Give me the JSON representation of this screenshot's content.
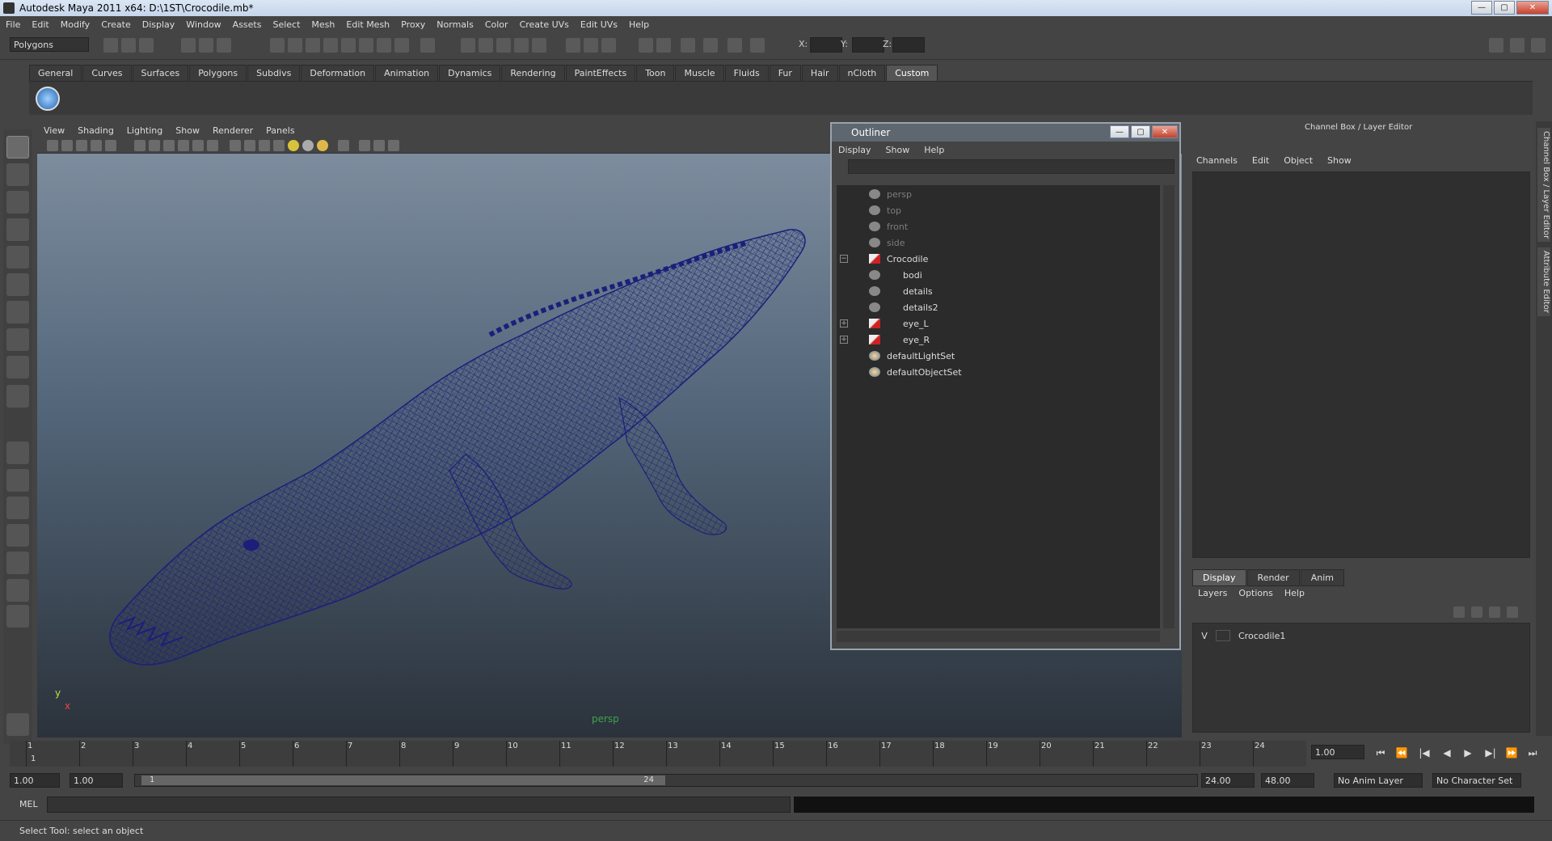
{
  "window": {
    "title": "Autodesk Maya 2011 x64: D:\\1ST\\Crocodile.mb*",
    "minimize": "—",
    "maximize": "▢",
    "close": "✕"
  },
  "menu": [
    "File",
    "Edit",
    "Modify",
    "Create",
    "Display",
    "Window",
    "Assets",
    "Select",
    "Mesh",
    "Edit Mesh",
    "Proxy",
    "Normals",
    "Color",
    "Create UVs",
    "Edit UVs",
    "Help"
  ],
  "status_line": {
    "mode": "Polygons",
    "x_label": "X:",
    "y_label": "Y:",
    "z_label": "Z:"
  },
  "shelf_tabs": [
    "General",
    "Curves",
    "Surfaces",
    "Polygons",
    "Subdivs",
    "Deformation",
    "Animation",
    "Dynamics",
    "Rendering",
    "PaintEffects",
    "Toon",
    "Muscle",
    "Fluids",
    "Fur",
    "Hair",
    "nCloth",
    "Custom"
  ],
  "shelf_active": "Custom",
  "viewport": {
    "menu": [
      "View",
      "Shading",
      "Lighting",
      "Show",
      "Renderer",
      "Panels"
    ],
    "camera_label": "persp",
    "axis_y": "y",
    "axis_x": "x",
    "wire_color": "#1c1f7a"
  },
  "outliner": {
    "title": "Outliner",
    "menu": [
      "Display",
      "Show",
      "Help"
    ],
    "items": [
      {
        "label": "persp",
        "dim": true,
        "type": "camera"
      },
      {
        "label": "top",
        "dim": true,
        "type": "camera"
      },
      {
        "label": "front",
        "dim": true,
        "type": "camera"
      },
      {
        "label": "side",
        "dim": true,
        "type": "camera"
      },
      {
        "label": "Crocodile",
        "dim": false,
        "type": "xform",
        "expander": "−"
      },
      {
        "label": "bodi",
        "dim": false,
        "type": "mesh"
      },
      {
        "label": "details",
        "dim": false,
        "type": "mesh"
      },
      {
        "label": "details2",
        "dim": false,
        "type": "mesh"
      },
      {
        "label": "eye_L",
        "dim": false,
        "type": "xform",
        "expander": "+"
      },
      {
        "label": "eye_R",
        "dim": false,
        "type": "xform",
        "expander": "+"
      },
      {
        "label": "defaultLightSet",
        "dim": false,
        "type": "set"
      },
      {
        "label": "defaultObjectSet",
        "dim": false,
        "type": "set"
      }
    ]
  },
  "channel_box": {
    "title": "Channel Box / Layer Editor",
    "menu": [
      "Channels",
      "Edit",
      "Object",
      "Show"
    ],
    "layer_tabs": [
      "Display",
      "Render",
      "Anim"
    ],
    "layer_tab_active": "Display",
    "layer_menu": [
      "Layers",
      "Options",
      "Help"
    ],
    "layers": [
      {
        "visible": "V",
        "name": "Crocodile1"
      }
    ]
  },
  "side_tabs": [
    "Channel Box / Layer Editor",
    "Attribute Editor"
  ],
  "time_slider": {
    "frames": [
      "1",
      "2",
      "3",
      "4",
      "5",
      "6",
      "7",
      "8",
      "9",
      "10",
      "11",
      "12",
      "13",
      "14",
      "15",
      "16",
      "17",
      "18",
      "19",
      "20",
      "21",
      "22",
      "23",
      "24"
    ],
    "current_marker": "1",
    "current_frame": "1.00"
  },
  "playback": [
    "⏮",
    "⏪",
    "|◀",
    "◀",
    "▶",
    "▶|",
    "⏩",
    "⏭"
  ],
  "range": {
    "start": "1.00",
    "playback_start": "1.00",
    "handle_start": "1",
    "handle_end": "24",
    "playback_end": "24.00",
    "end": "48.00",
    "anim_layer": "No Anim Layer",
    "character_set": "No Character Set"
  },
  "command_line": {
    "label": "MEL"
  },
  "help_line": "Select Tool: select an object"
}
